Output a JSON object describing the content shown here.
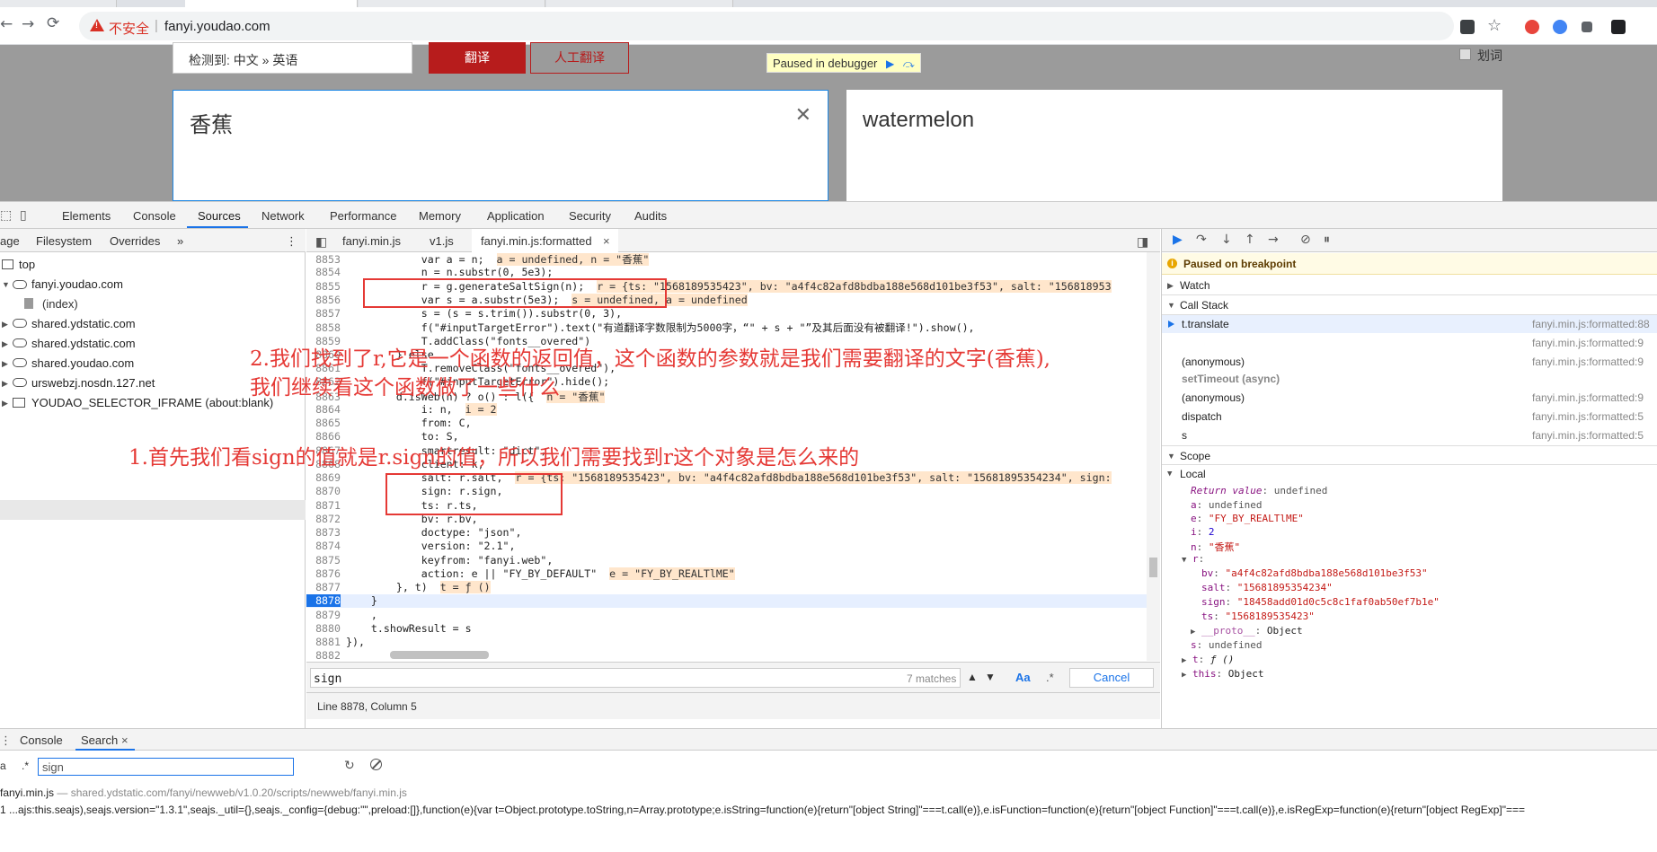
{
  "browser": {
    "insecure_label": "不安全",
    "separator": "|",
    "url": "fanyi.youdao.com",
    "back_glyph": "←",
    "forward_glyph": "→",
    "reload_glyph": "⟳",
    "star_glyph": "☆",
    "ext_colors": [
      "#e8453c",
      "#4285f4",
      "#34a853",
      "#5f6368",
      "#202124"
    ]
  },
  "page": {
    "detect_label": "检测到: 中文 » 英语",
    "detect_chevron": "⌄",
    "translate_button": "翻译",
    "human_translate_button": "人工翻译",
    "paused_label": "Paused in debugger",
    "resume_glyph": "▶",
    "step_glyph": "⤼",
    "cihui_label": "划词",
    "source_text": "香蕉",
    "close_glyph": "✕",
    "output_text": "watermelon"
  },
  "devtools": {
    "tabs": [
      "Elements",
      "Console",
      "Sources",
      "Network",
      "Performance",
      "Memory",
      "Application",
      "Security",
      "Audits"
    ],
    "navigator": {
      "tabs": [
        "age",
        "Filesystem",
        "Overrides",
        "»"
      ],
      "menu_glyph": "⋮",
      "items": [
        "top",
        "fanyi.youdao.com",
        "(index)",
        "shared.ydstatic.com",
        "shared.ydstatic.com",
        "shared.youdao.com",
        "urswebzj.nosdn.127.net",
        "YOUDAO_SELECTOR_IFRAME (about:blank)"
      ]
    },
    "editor": {
      "tabs": [
        "fanyi.min.js",
        "v1.js",
        "fanyi.min.js:formatted"
      ],
      "tab_close": "×",
      "lines": [
        {
          "n": "8853",
          "code": "            var a = n;",
          "ann": "a = undefined, n = \"香蕉\""
        },
        {
          "n": "8854",
          "code": "            n = n.substr(0, 5e3);",
          "ann": ""
        },
        {
          "n": "8855",
          "code": "            r = g.generateSaltSign(n);",
          "ann": "r = {ts: \"1568189535423\", bv: \"a4f4c82afd8bdba188e568d101be3f53\", salt: \"156818953"
        },
        {
          "n": "8856",
          "code": "            var s = a.substr(5e3);",
          "ann": "s = undefined, a = undefined"
        },
        {
          "n": "8857",
          "code": "            s = (s = s.trim()).substr(0, 3),",
          "ann": ""
        },
        {
          "n": "8858",
          "code": "            f(\"#inputTargetError\").text(\"有道翻译字数限制为5000字，“\" + s + \"”及其后面没有被翻译!\").show(),",
          "ann": ""
        },
        {
          "n": "8859",
          "code": "            T.addClass(\"fonts__overed\")",
          "ann": ""
        },
        {
          "n": "8860",
          "code": "        } else",
          "ann": ""
        },
        {
          "n": "8861",
          "code": "            T.removeClass(\"fonts__overed\"),",
          "ann": ""
        },
        {
          "n": "8862",
          "code": "            f(\"#inputTargetError\").hide();",
          "ann": ""
        },
        {
          "n": "8863",
          "code": "        d.isWeb(n) ? o() : l({",
          "ann": "n = \"香蕉\""
        },
        {
          "n": "8864",
          "code": "            i: n,",
          "ann": "i = 2"
        },
        {
          "n": "8865",
          "code": "            from: C,",
          "ann": ""
        },
        {
          "n": "8866",
          "code": "            to: S,",
          "ann": ""
        },
        {
          "n": "8867",
          "code": "            smartresult: \"dict\",",
          "ann": ""
        },
        {
          "n": "8868",
          "code": "            client: k,",
          "ann": ""
        },
        {
          "n": "8869",
          "code": "            salt: r.salt,",
          "ann": "r = {ts: \"1568189535423\", bv: \"a4f4c82afd8bdba188e568d101be3f53\", salt: \"15681895354234\", sign:"
        },
        {
          "n": "8870",
          "code": "            sign: r.sign,",
          "ann": ""
        },
        {
          "n": "8871",
          "code": "            ts: r.ts,",
          "ann": ""
        },
        {
          "n": "8872",
          "code": "            bv: r.bv,",
          "ann": ""
        },
        {
          "n": "8873",
          "code": "            doctype: \"json\",",
          "ann": ""
        },
        {
          "n": "8874",
          "code": "            version: \"2.1\",",
          "ann": ""
        },
        {
          "n": "8875",
          "code": "            keyfrom: \"fanyi.web\",",
          "ann": ""
        },
        {
          "n": "8876",
          "code": "            action: e || \"FY_BY_DEFAULT\"",
          "ann": "e = \"FY_BY_REALTlME\""
        },
        {
          "n": "8877",
          "code": "        }, t)",
          "ann": "t = ƒ ()"
        },
        {
          "n": "8878",
          "code": "    }",
          "ann": ""
        },
        {
          "n": "8879",
          "code": "    ,",
          "ann": ""
        },
        {
          "n": "8880",
          "code": "    t.showResult = s",
          "ann": ""
        },
        {
          "n": "8881",
          "code": "}),",
          "ann": ""
        },
        {
          "n": "8882",
          "code": "",
          "ann": ""
        }
      ],
      "find_query": "sign",
      "find_count": "7 matches",
      "find_up": "▲",
      "find_down": "▼",
      "find_case": "Aa",
      "find_regex": ".*",
      "find_cancel": "Cancel",
      "status": "Line 8878, Column 5"
    },
    "debugger": {
      "buttons": [
        "▶",
        "↷",
        "↓",
        "↑",
        "→",
        "⊘",
        "⏸"
      ],
      "paused_banner": "Paused on breakpoint",
      "info_glyph": "i",
      "watch_label": "Watch",
      "callstack_label": "Call Stack",
      "frames": [
        {
          "fn": "t.translate",
          "loc": "fanyi.min.js:formatted:88"
        },
        {
          "fn": "",
          "loc": "fanyi.min.js:formatted:9"
        },
        {
          "fn": "(anonymous)",
          "loc": "fanyi.min.js:formatted:9"
        },
        {
          "fn": "(anonymous)",
          "loc": "fanyi.min.js:formatted:9"
        },
        {
          "fn": "dispatch",
          "loc": "fanyi.min.js:formatted:5"
        },
        {
          "fn": "s",
          "loc": "fanyi.min.js:formatted:5"
        }
      ],
      "async_label": "setTimeout (async)",
      "scope_label": "Scope",
      "local_label": "Local",
      "scope": {
        "return_key": "Return value",
        "return_val": "undefined",
        "a_key": "a",
        "a_val": "undefined",
        "e_key": "e",
        "e_val": "\"FY_BY_REALTlME\"",
        "i_key": "i",
        "i_val": "2",
        "n_key": "n",
        "n_val": "\"香蕉\"",
        "r_key": "r",
        "bv_key": "bv",
        "bv_val": "\"a4f4c82afd8bdba188e568d101be3f53\"",
        "salt_key": "salt",
        "salt_val": "\"15681895354234\"",
        "sign_key": "sign",
        "sign_val": "\"18458add01d0c5c8c1faf0ab50ef7b1e\"",
        "ts_key": "ts",
        "ts_val": "\"1568189535423\"",
        "proto_key": "__proto__",
        "proto_val": "Object",
        "s_key": "s",
        "s_val": "undefined",
        "t_key": "t",
        "t_val": "ƒ ()",
        "this_key": "this",
        "this_val": "Object"
      }
    },
    "drawer": {
      "tabs": [
        "Console",
        "Search"
      ],
      "tab_close": "×",
      "aa": "a",
      "regex": ".*",
      "refresh_glyph": "↻",
      "query": "sign",
      "result_file": "fanyi.min.js",
      "result_path": " — shared.ydstatic.com/fanyi/newweb/v1.0.20/scripts/newweb/fanyi.min.js",
      "result_line": "1   ...ajs:this.seajs),seajs.version=\"1.3.1\",seajs._util={},seajs._config={debug:\"\",preload:[]},function(e){var t=Object.prototype.toString,n=Array.prototype;e.isString=function(e){return\"[object String]\"===t.call(e)},e.isFunction=function(e){return\"[object Function]\"===t.call(e)},e.isRegExp=function(e){return\"[object RegExp]\"==="
    }
  },
  "annotations": {
    "note1": "1.首先我们看sign的值就是r.sign的值，所以我们需要找到r这个对象是怎么来的",
    "note2_line1": "2.我们找到了r,它是一个函数的返回值，这个函数的参数就是我们需要翻译的文字(香蕉),",
    "note2_line2": "我们继续看这个函数做了一些什么",
    "color": "#e53935"
  }
}
